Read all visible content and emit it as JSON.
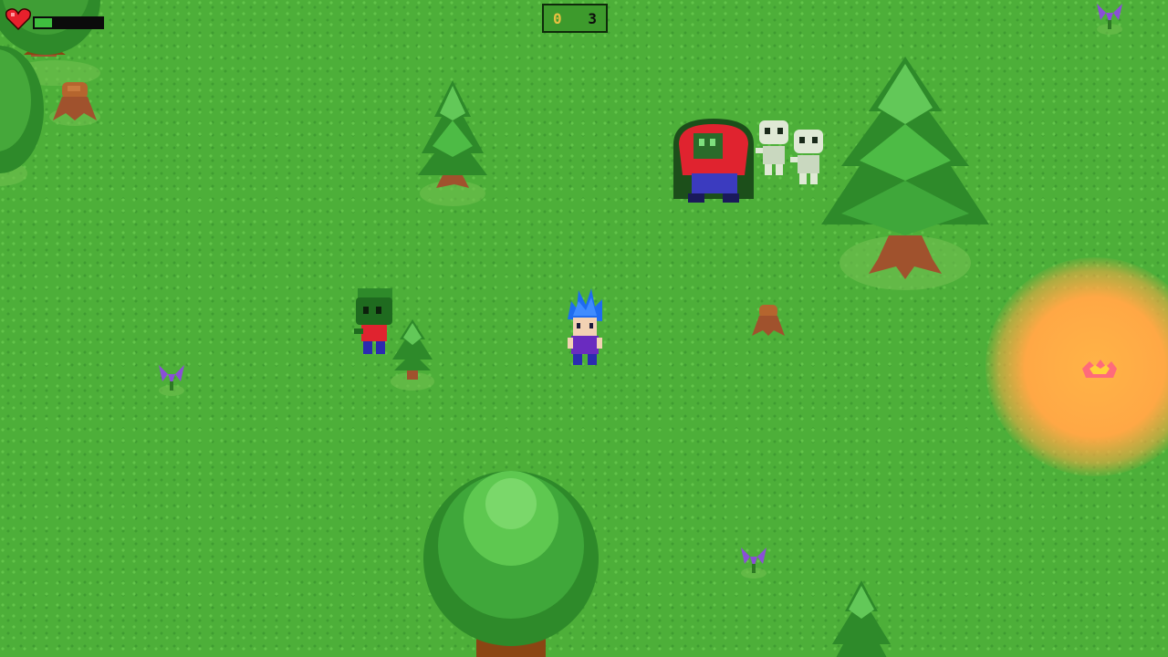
{
  "hud": {
    "health_fraction": 0.25,
    "coin_value": "0",
    "counter_value": "3"
  },
  "colors": {
    "grass": "#4daf39",
    "hp_fill": "#3fbf3f",
    "hud_box": "#3d9a2c",
    "tree_dark": "#2e8a2a",
    "tree_light": "#5ec850",
    "trunk": "#a0522d",
    "glow": "#ffa845"
  },
  "icons": [
    "heart-icon",
    "coin-icon",
    "flower-icon",
    "stump-icon"
  ]
}
